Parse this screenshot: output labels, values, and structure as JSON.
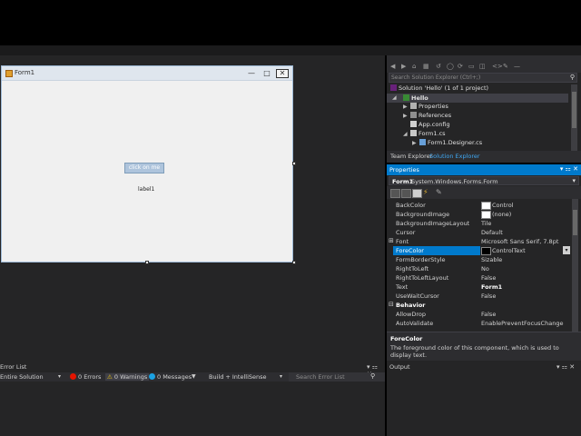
{
  "designer": {
    "form_title": "Form1",
    "button_label": "click on me",
    "label_text": "label1"
  },
  "solution_explorer": {
    "search_placeholder": "Search Solution Explorer (Ctrl+;)",
    "tree": [
      {
        "label": "Solution 'Hello' (1 of 1 project)",
        "icon": "solution-icon"
      },
      {
        "label": "Hello",
        "icon": "csharp-project-icon"
      },
      {
        "label": "Properties",
        "icon": "wrench-icon"
      },
      {
        "label": "References",
        "icon": "references-icon"
      },
      {
        "label": "App.config",
        "icon": "config-file-icon"
      },
      {
        "label": "Form1.cs",
        "icon": "form-file-icon"
      },
      {
        "label": "Form1.Designer.cs",
        "icon": "cs-file-icon"
      }
    ],
    "tabs": [
      "Team Explorer",
      "Solution Explorer"
    ]
  },
  "properties": {
    "title": "Properties",
    "object_name": "Form1",
    "object_type": "System.Windows.Forms.Form",
    "rows": [
      {
        "name": "BackColor",
        "value": "Control",
        "swatch": "#ffffff"
      },
      {
        "name": "BackgroundImage",
        "value": "(none)",
        "swatch": "#ffffff"
      },
      {
        "name": "BackgroundImageLayout",
        "value": "Tile"
      },
      {
        "name": "Cursor",
        "value": "Default"
      },
      {
        "name": "Font",
        "value": "Microsoft Sans Serif, 7.8pt",
        "expandable": true
      },
      {
        "name": "ForeColor",
        "value": "ControlText",
        "selected": true,
        "swatch": "#000000"
      },
      {
        "name": "FormBorderStyle",
        "value": "Sizable"
      },
      {
        "name": "RightToLeft",
        "value": "No"
      },
      {
        "name": "RightToLeftLayout",
        "value": "False"
      },
      {
        "name": "Text",
        "value": "Form1",
        "bold": true
      },
      {
        "name": "UseWaitCursor",
        "value": "False"
      }
    ],
    "category_behavior": "Behavior",
    "rows2": [
      {
        "name": "AllowDrop",
        "value": "False"
      },
      {
        "name": "AutoValidate",
        "value": "EnablePreventFocusChange"
      }
    ],
    "desc_title": "ForeColor",
    "desc_text": "The foreground color of this component, which is used to display text."
  },
  "error_list": {
    "title": "Error List",
    "scope": "Entire Solution",
    "errors": "0 Errors",
    "warnings": "0 Warnings",
    "messages": "0 Messages",
    "build_filter": "Build + IntelliSense",
    "search_placeholder": "Search Error List"
  },
  "output": {
    "title": "Output"
  },
  "colors": {
    "accent": "#007acc",
    "selected": "#007acc"
  }
}
